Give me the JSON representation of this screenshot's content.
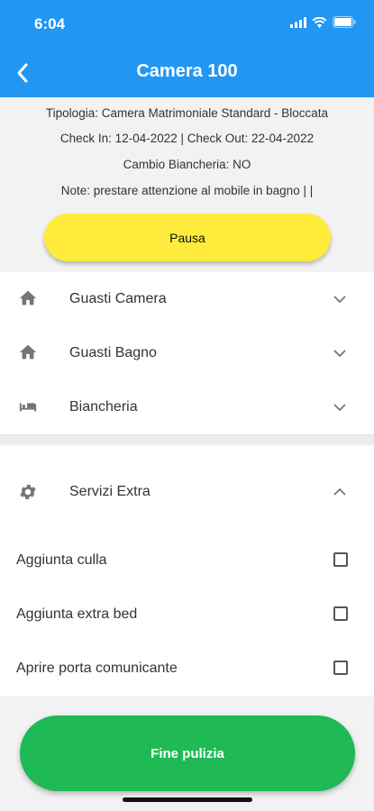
{
  "status_bar": {
    "time": "6:04"
  },
  "header": {
    "title": "Camera 100",
    "back_icon": "chevron-left-icon"
  },
  "info": {
    "tipologia": "Tipologia: Camera Matrimoniale Standard - Bloccata",
    "check": "Check In: 12-04-2022 | Check Out: 22-04-2022",
    "cambio": "Cambio Biancheria: NO",
    "note": "Note: prestare attenzione al mobile in bagno |  |"
  },
  "pausa_label": "Pausa",
  "sections": [
    {
      "label": "Guasti Camera",
      "icon": "home-icon",
      "expanded": false
    },
    {
      "label": "Guasti Bagno",
      "icon": "home-icon",
      "expanded": false
    },
    {
      "label": "Biancheria",
      "icon": "bed-icon",
      "expanded": false
    },
    {
      "label": "Servizi Extra",
      "icon": "gear-icon",
      "expanded": true
    }
  ],
  "extras": [
    {
      "label": "Aggiunta culla",
      "checked": false
    },
    {
      "label": "Aggiunta extra bed",
      "checked": false
    },
    {
      "label": "Aprire porta comunicante",
      "checked": false
    }
  ],
  "fine_label": "Fine pulizia",
  "colors": {
    "header": "#2196f3",
    "pausa": "#ffeb3b",
    "fine": "#1fba55"
  }
}
